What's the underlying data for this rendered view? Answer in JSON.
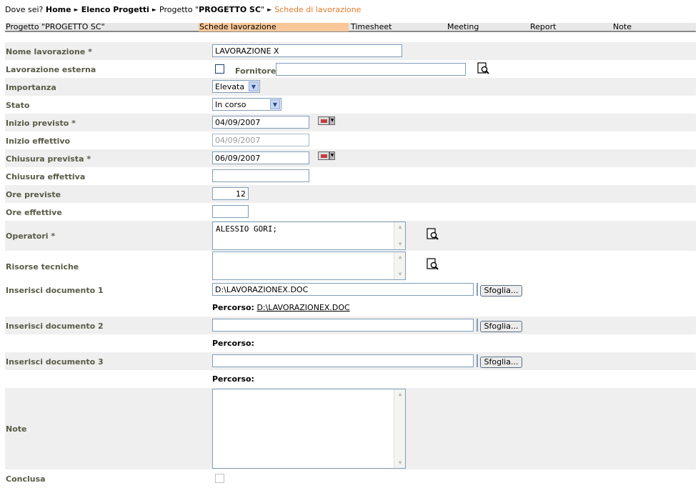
{
  "breadcrumb": {
    "prefix": "Dove sei?",
    "home": "Home",
    "list": "Elenco Progetti",
    "project_prefix": "Progetto \"",
    "project_name": "PROGETTO SC",
    "project_suffix": "\"",
    "current": "Schede di lavorazione"
  },
  "tabs": [
    {
      "label": "Progetto \"PROGETTO SC\""
    },
    {
      "label": "Schede lavorazione"
    },
    {
      "label": "Timesheet"
    },
    {
      "label": "Meeting"
    },
    {
      "label": "Report"
    },
    {
      "label": "Note"
    }
  ],
  "form": {
    "nome": {
      "label": "Nome lavorazione *",
      "value": "LAVORAZIONE X"
    },
    "esterna": {
      "label": "Lavorazione esterna",
      "checked": false,
      "fornitore_label": "Fornitore",
      "fornitore_value": ""
    },
    "importanza": {
      "label": "Importanza",
      "value": "Elevata"
    },
    "stato": {
      "label": "Stato",
      "value": "In corso"
    },
    "inizio_previsto": {
      "label": "Inizio previsto *",
      "value": "04/09/2007"
    },
    "inizio_effettivo": {
      "label": "Inizio effettivo",
      "value": "04/09/2007"
    },
    "chiusura_prevista": {
      "label": "Chiusura prevista *",
      "value": "06/09/2007"
    },
    "chiusura_effettiva": {
      "label": "Chiusura effettiva",
      "value": ""
    },
    "ore_previste": {
      "label": "Ore previste",
      "value": "12"
    },
    "ore_effettive": {
      "label": "Ore effettive",
      "value": ""
    },
    "operatori": {
      "label": "Operatori *",
      "value": "ALESSIO GORI;"
    },
    "risorse": {
      "label": "Risorse tecniche",
      "value": ""
    },
    "doc1": {
      "label": "Inserisci documento 1",
      "value": "D:\\LAVORAZIONEX.DOC",
      "button": "Sfoglia...",
      "path_label": "Percorso:",
      "path_value": "D:\\LAVORAZIONEX.DOC"
    },
    "doc2": {
      "label": "Inserisci documento 2",
      "value": "",
      "button": "Sfoglia...",
      "path_label": "Percorso:",
      "path_value": ""
    },
    "doc3": {
      "label": "Inserisci documento 3",
      "value": "",
      "button": "Sfoglia...",
      "path_label": "Percorso:",
      "path_value": ""
    },
    "note": {
      "label": "Note",
      "value": ""
    },
    "conclusa": {
      "label": "Conclusa",
      "checked": false
    }
  },
  "colors": {
    "accent": "#e07a2a",
    "active_tab": "#f8c89a",
    "label": "#5a5a48",
    "row_shade": "#efefef"
  }
}
